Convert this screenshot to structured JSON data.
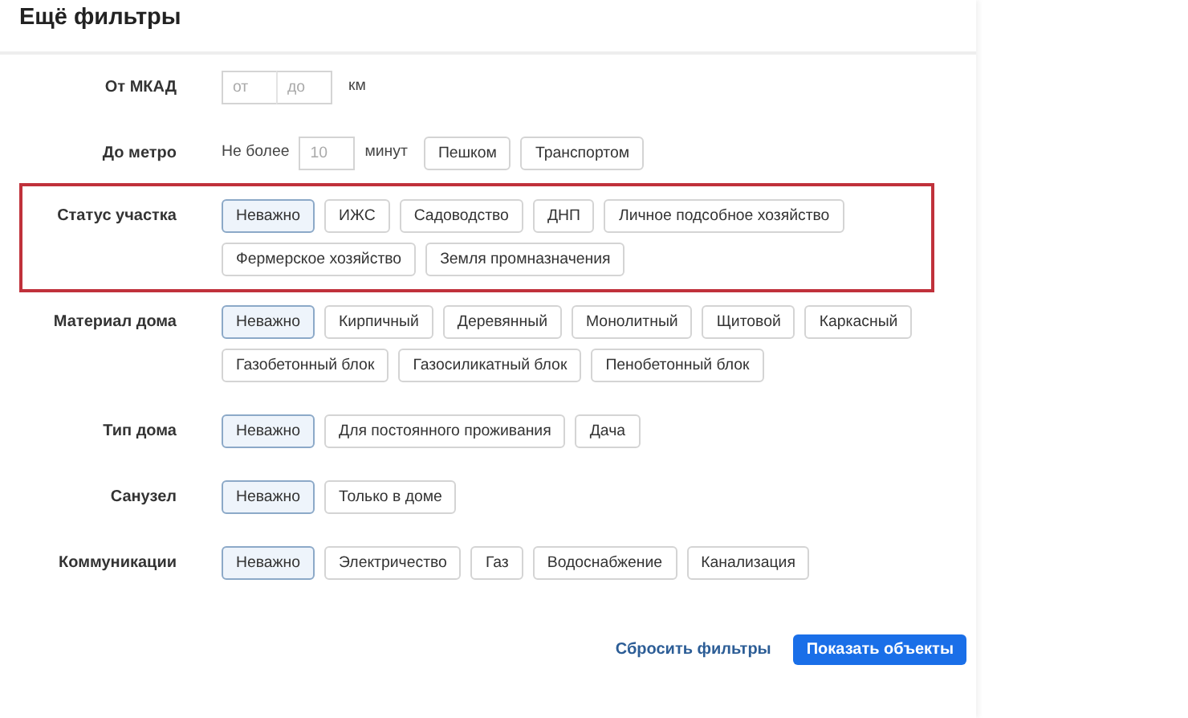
{
  "title": "Ещё фильтры",
  "filters": [
    {
      "kind": "range",
      "label": "От МКАД",
      "highlighted": false,
      "fields": [
        {
          "placeholder": "от"
        },
        {
          "placeholder": "до"
        }
      ],
      "unit": "км"
    },
    {
      "kind": "metro",
      "label": "До метро",
      "highlighted": false,
      "prefix": "Не более",
      "field": {
        "placeholder": "10"
      },
      "unit": "минут",
      "options": [
        {
          "label": "Пешком",
          "selected": false
        },
        {
          "label": "Транспортом",
          "selected": false
        }
      ]
    },
    {
      "kind": "chips",
      "label": "Статус участка",
      "highlighted": true,
      "options": [
        {
          "label": "Неважно",
          "selected": true
        },
        {
          "label": "ИЖС",
          "selected": false
        },
        {
          "label": "Садоводство",
          "selected": false
        },
        {
          "label": "ДНП",
          "selected": false
        },
        {
          "label": "Личное подсобное хозяйство",
          "selected": false
        },
        {
          "label": "Фермерское хозяйство",
          "selected": false
        },
        {
          "label": "Земля промназначения",
          "selected": false
        }
      ]
    },
    {
      "kind": "chips",
      "label": "Материал дома",
      "highlighted": false,
      "options": [
        {
          "label": "Неважно",
          "selected": true
        },
        {
          "label": "Кирпичный",
          "selected": false
        },
        {
          "label": "Деревянный",
          "selected": false
        },
        {
          "label": "Монолитный",
          "selected": false
        },
        {
          "label": "Щитовой",
          "selected": false
        },
        {
          "label": "Каркасный",
          "selected": false
        },
        {
          "label": "Газобетонный блок",
          "selected": false
        },
        {
          "label": "Газосиликатный блок",
          "selected": false
        },
        {
          "label": "Пенобетонный блок",
          "selected": false
        }
      ]
    },
    {
      "kind": "chips",
      "label": "Тип дома",
      "highlighted": false,
      "options": [
        {
          "label": "Неважно",
          "selected": true
        },
        {
          "label": "Для постоянного проживания",
          "selected": false
        },
        {
          "label": "Дача",
          "selected": false
        }
      ]
    },
    {
      "kind": "chips",
      "label": "Санузел",
      "highlighted": false,
      "options": [
        {
          "label": "Неважно",
          "selected": true
        },
        {
          "label": "Только в доме",
          "selected": false
        }
      ]
    },
    {
      "kind": "chips",
      "label": "Коммуникации",
      "highlighted": false,
      "options": [
        {
          "label": "Неважно",
          "selected": true
        },
        {
          "label": "Электричество",
          "selected": false
        },
        {
          "label": "Газ",
          "selected": false
        },
        {
          "label": "Водоснабжение",
          "selected": false
        },
        {
          "label": "Канализация",
          "selected": false
        }
      ]
    }
  ],
  "footer": {
    "reset_link": "Сбросить фильтры",
    "submit_button": "Показать объекты"
  }
}
